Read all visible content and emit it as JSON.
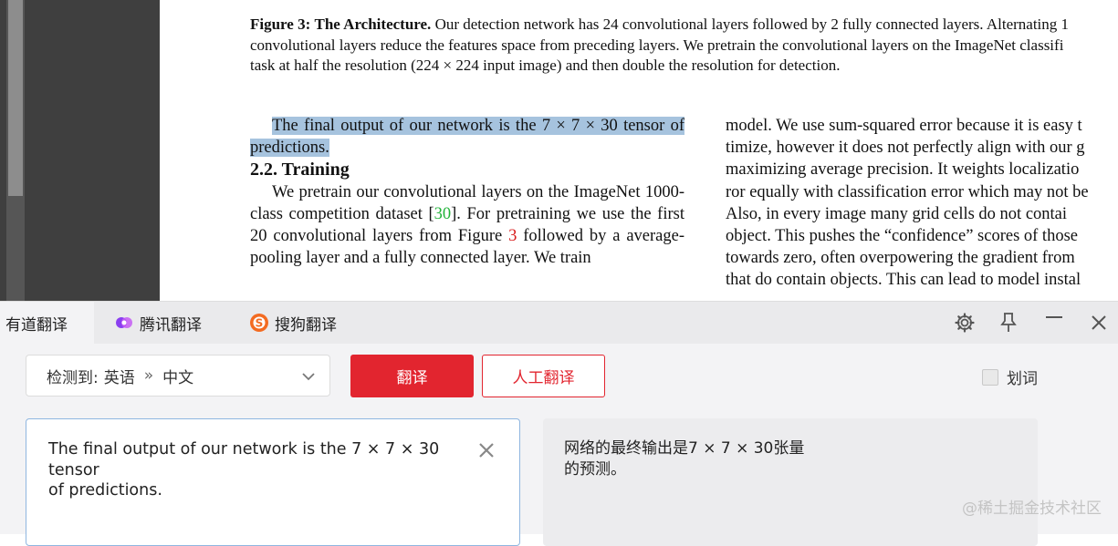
{
  "pdf": {
    "caption": {
      "label": "Figure 3:",
      "title": "The Architecture.",
      "line1_rest": "Our detection network has 24 convolutional layers followed by 2 fully connected layers. Alternating 1",
      "line2": "convolutional layers reduce the features space from preceding layers. We pretrain the convolutional layers on the ImageNet classifi",
      "line3": "task at half the resolution (224 × 224 input image) and then double the resolution for detection."
    },
    "left_column": {
      "highlighted_para": "The final output of our network is the 7 × 7 × 30 tensor of predictions.",
      "section_heading": "2.2. Training",
      "para_start": "We pretrain our convolutional layers on the ImageNet 1000-class competition dataset [",
      "ref_30": "30",
      "para_mid": "]. For pretraining we use the first 20 convolutional layers from Figure ",
      "ref_fig": "3",
      "para_end": " followed by a average-pooling layer and a fully connected layer. We train"
    },
    "right_column": {
      "lines": [
        "model.  We use sum-squared error because it is easy t",
        "timize, however it does not perfectly align with our g",
        "maximizing average precision.  It weights localizatio",
        "ror equally with classification error which may not be",
        "Also, in every image many grid cells do not contai",
        "object.  This pushes the “confidence” scores of those",
        "towards zero, often overpowering the gradient from",
        "that do contain objects.  This can lead to model instal"
      ]
    }
  },
  "translator": {
    "tabs": [
      {
        "label": "有道翻译",
        "icon": "youdao-logo"
      },
      {
        "label": "腾讯翻译",
        "icon": "tencent-logo"
      },
      {
        "label": "搜狗翻译",
        "icon": "sogou-logo"
      }
    ],
    "lang": {
      "detected_label": "检测到:",
      "source": "英语",
      "arrow": "»",
      "target": "中文"
    },
    "translate_button": "翻译",
    "human_button": "人工翻译",
    "word_pick_label": "划词",
    "source_text": "The final output of our network is the 7 × 7 × 30\ntensor\nof predictions.",
    "result_text": "网络的最终输出是7 × 7 × 30张量\n的预测。",
    "colors": {
      "accent": "#e2252f",
      "highlight": "#a6c3de",
      "link_green": "#22b33a",
      "link_red": "#d81d1d"
    }
  },
  "watermark": "@稀土掘金技术社区"
}
